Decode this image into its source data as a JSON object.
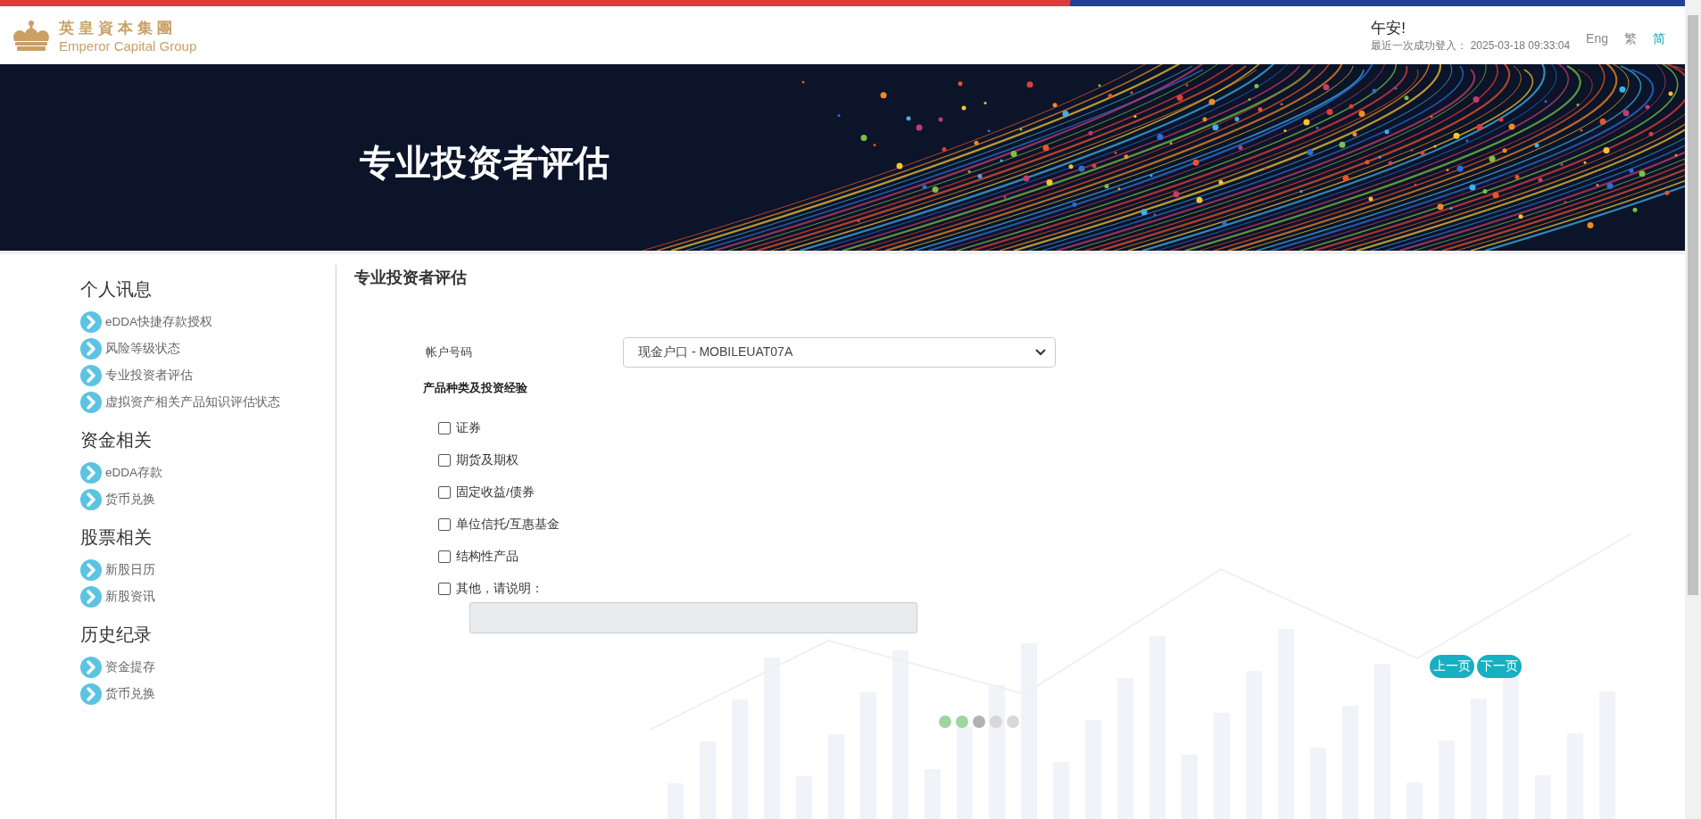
{
  "header": {
    "logo": {
      "chinese": "英皇資本集團",
      "english": "Emperor Capital Group"
    },
    "greeting": "午安!",
    "last_login": "最近一次成功登入： 2025-03-18 09:33:04",
    "languages": [
      {
        "label": "Eng",
        "selected": false
      },
      {
        "label": "繁",
        "selected": false
      },
      {
        "label": "简",
        "selected": true
      }
    ]
  },
  "banner": {
    "title": "专业投资者评估"
  },
  "sidebar": {
    "sections": [
      {
        "title": "个人讯息",
        "items": [
          "eDDA快捷存款授权",
          "风险等级状态",
          "专业投资者评估",
          "虚拟资产相关产品知识评估状态"
        ]
      },
      {
        "title": "资金相关",
        "items": [
          "eDDA存款",
          "货币兑换"
        ]
      },
      {
        "title": "股票相关",
        "items": [
          "新股日历",
          "新股资讯"
        ]
      },
      {
        "title": "历史纪录",
        "items": [
          "资金提存",
          "货币兑换"
        ]
      }
    ]
  },
  "content": {
    "title": "专业投资者评估",
    "account": {
      "label": "帐户号码",
      "value": "现金户口 - MOBILEUAT07A"
    },
    "section_title": "产品种类及投资经验",
    "options": [
      {
        "label": "证券",
        "checked": false
      },
      {
        "label": "期货及期权",
        "checked": false
      },
      {
        "label": "固定收益/债券",
        "checked": false
      },
      {
        "label": "单位信托/互惠基金",
        "checked": false
      },
      {
        "label": "结构性产品",
        "checked": false
      },
      {
        "label": "其他，请说明：",
        "checked": false
      }
    ],
    "other_field": {
      "disabled": true
    },
    "buttons": [
      "上一页",
      "下一页"
    ],
    "steps": [
      {
        "color": "#9fd59f"
      },
      {
        "color": "#9fd59f"
      },
      {
        "color": "#b2b2b2"
      },
      {
        "color": "#d8d8d8"
      },
      {
        "color": "#d8d8d8"
      }
    ]
  }
}
